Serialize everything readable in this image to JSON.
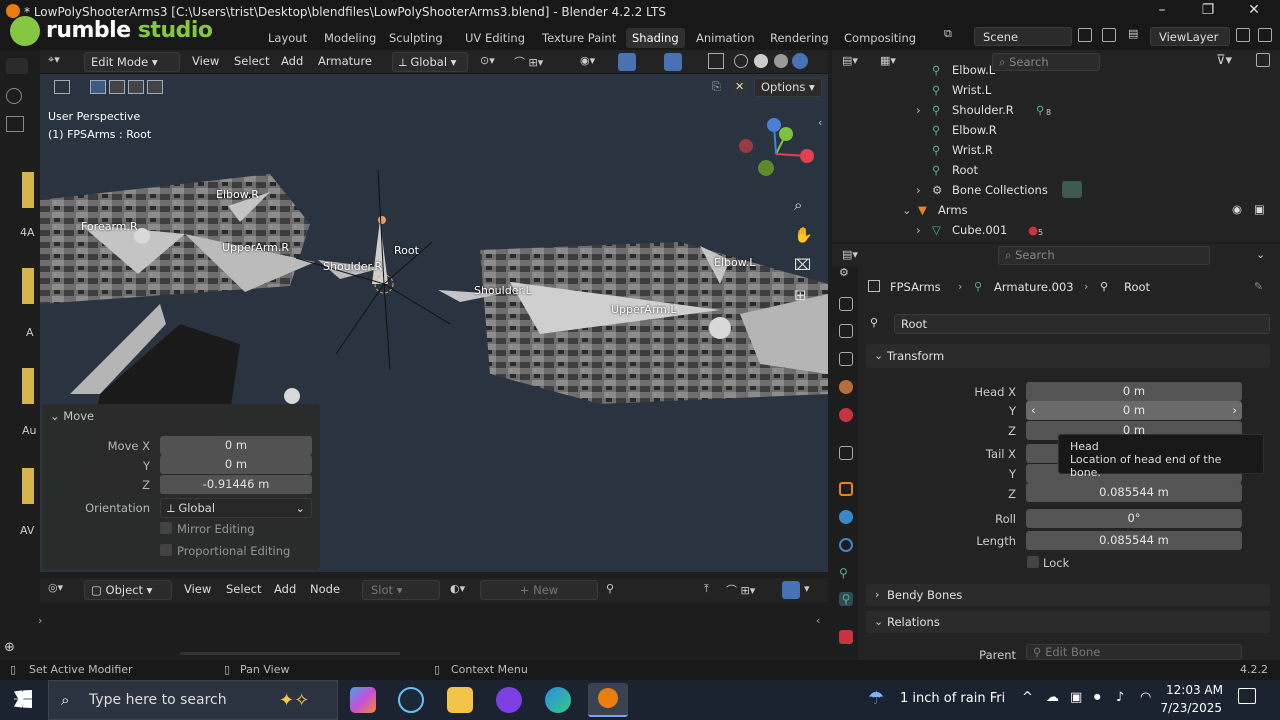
{
  "title_bar": {
    "title": "* LowPolyShooterArms3 [C:\\Users\\trist\\Desktop\\blendfiles\\LowPolyShooterArms3.blend] - Blender 4.2.2 LTS"
  },
  "overlay_brand": {
    "logo_text": "rumble",
    "logo_text_2": "studio"
  },
  "workspaces": [
    "Layout",
    "Modeling",
    "Sculpting",
    "UV Editing",
    "Texture Paint",
    "Shading",
    "Animation",
    "Rendering",
    "Compositing"
  ],
  "active_workspace": "Shading",
  "scene": {
    "name": "Scene",
    "view_layer": "ViewLayer"
  },
  "viewport_header": {
    "mode": "Edit Mode",
    "menus": [
      "View",
      "Select",
      "Add",
      "Armature"
    ],
    "orientation": "Global",
    "options": "Options"
  },
  "viewport": {
    "line1": "User Perspective",
    "line2": "(1) FPSArms : Root"
  },
  "bone_labels": [
    "Elbow.R",
    "Forearm.R",
    "UpperArm.R",
    "Shoulder.R",
    "Root",
    "Shoulder.L",
    "UpperArm.L",
    "Elbow.L"
  ],
  "move_panel": {
    "title": "Move",
    "move_x_label": "Move X",
    "move_x": "0 m",
    "y_label": "Y",
    "move_y": "0 m",
    "z_label": "Z",
    "move_z": "-0.91446 m",
    "orientation_label": "Orientation",
    "orientation": "Global",
    "mirror": "Mirror Editing",
    "proportional": "Proportional Editing"
  },
  "left_strip": {
    "a1": "4A",
    "a2": "A",
    "a3": "Au",
    "a4": "AV"
  },
  "outliner": {
    "search_placeholder": "Search",
    "rows": [
      {
        "label": "Elbow.L"
      },
      {
        "label": "Wrist.L"
      },
      {
        "label": "Shoulder.R",
        "badge": "8"
      },
      {
        "label": "Elbow.R"
      },
      {
        "label": "Wrist.R"
      },
      {
        "label": "Root"
      },
      {
        "label": "Bone Collections"
      },
      {
        "label": "Arms"
      },
      {
        "label": "Cube.001",
        "badge": "5"
      }
    ]
  },
  "properties": {
    "search_placeholder": "Search",
    "breadcrumb": [
      "FPSArms",
      "Armature.003",
      "Root"
    ],
    "bone_name": "Root",
    "transform_title": "Transform",
    "head_x_label": "Head X",
    "head_x": "0 m",
    "head_y_label": "Y",
    "head_y": "0 m",
    "head_z_label": "Z",
    "head_z": "0 m",
    "tail_x_label": "Tail X",
    "tail_y_label": "Y",
    "tail_z_label": "Z",
    "tail_z": "0.085544 m",
    "roll_label": "Roll",
    "roll": "0°",
    "length_label": "Length",
    "length": "0.085544 m",
    "lock": "Lock",
    "bendy": "Bendy Bones",
    "relations": "Relations",
    "parent_label": "Parent",
    "parent_placeholder": "Edit Bone"
  },
  "tooltip": {
    "title": "Head",
    "desc": "Location of head end of the bone."
  },
  "node_header": {
    "mode": "Object",
    "menus": [
      "View",
      "Select",
      "Add",
      "Node"
    ],
    "slot": "Slot",
    "new": "New"
  },
  "status_bar": {
    "left": "Set Active Modifier",
    "mid": "Pan View",
    "right": "Context Menu",
    "version": "4.2.2"
  },
  "taskbar": {
    "search_placeholder": "Type here to search",
    "weather": "1 inch of rain Fri",
    "time": "12:03 AM",
    "date": "7/23/2025"
  },
  "colors": {
    "bone_green": "#4db38f",
    "accent_blue": "#4772b3",
    "viewport_bg": "#2a3340"
  }
}
